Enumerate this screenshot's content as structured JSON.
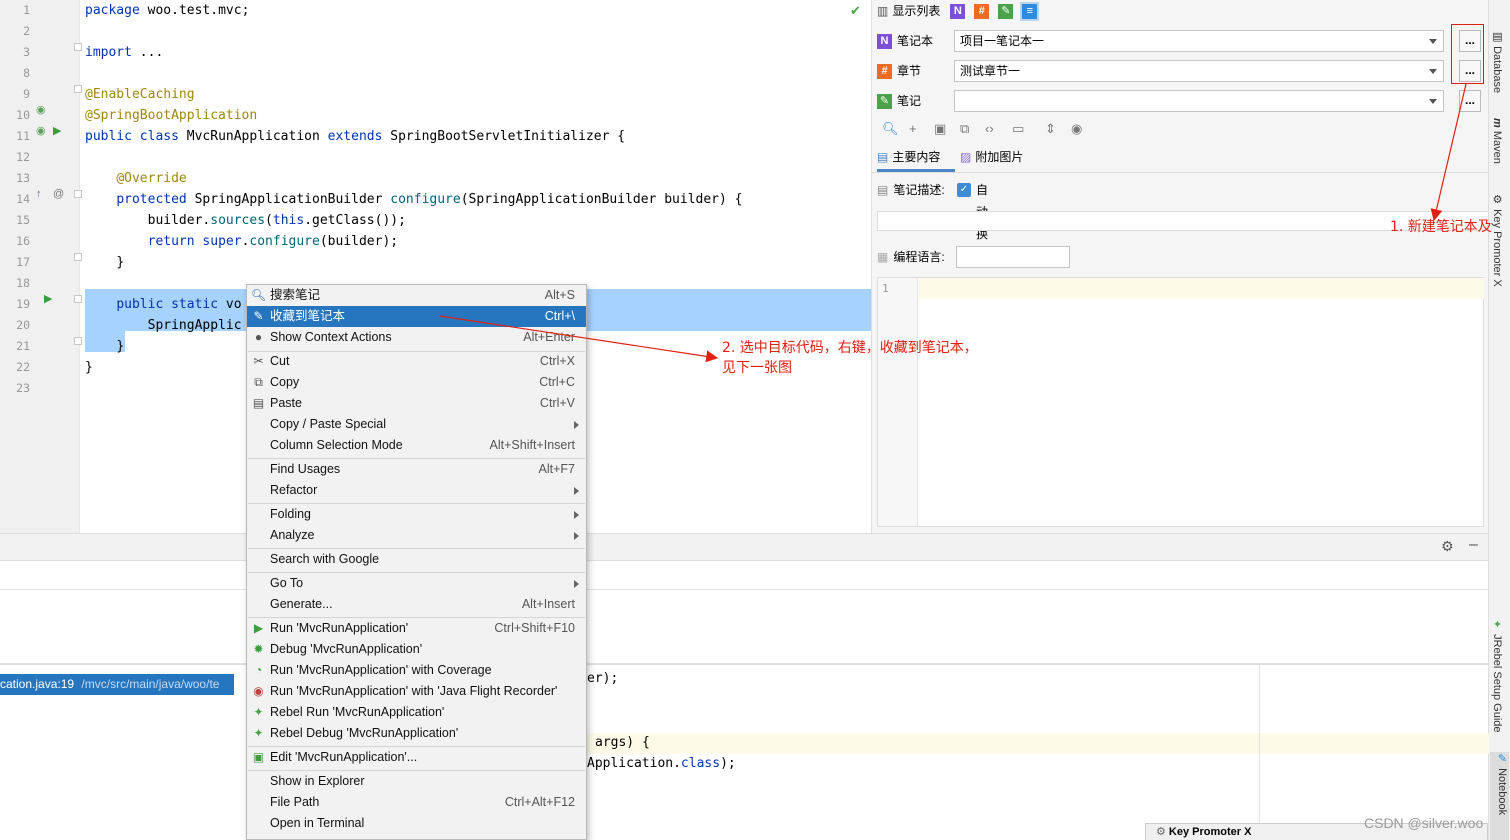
{
  "editor": {
    "lines": [
      {
        "num": "1",
        "text": "package woo.test.mvc;"
      },
      {
        "num": "2",
        "text": ""
      },
      {
        "num": "3",
        "text": "import ..."
      },
      {
        "num": "8",
        "text": ""
      },
      {
        "num": "9",
        "text": "@EnableCaching"
      },
      {
        "num": "10",
        "text": "@SpringBootApplication"
      },
      {
        "num": "11",
        "text": "public class MvcRunApplication extends SpringBootServletInitializer {"
      },
      {
        "num": "12",
        "text": ""
      },
      {
        "num": "13",
        "text": "    @Override"
      },
      {
        "num": "14",
        "text": "    protected SpringApplicationBuilder configure(SpringApplicationBuilder builder) {"
      },
      {
        "num": "15",
        "text": "        builder.sources(this.getClass());"
      },
      {
        "num": "16",
        "text": "        return super.configure(builder);"
      },
      {
        "num": "17",
        "text": "    }"
      },
      {
        "num": "18",
        "text": ""
      },
      {
        "num": "19",
        "text": "    public static vo"
      },
      {
        "num": "20",
        "text": "        SpringApplic"
      },
      {
        "num": "21",
        "text": "    }"
      },
      {
        "num": "22",
        "text": "}"
      },
      {
        "num": "23",
        "text": ""
      }
    ]
  },
  "panel": {
    "display_list_label": "显示列表",
    "notebook_label": "笔记本",
    "notebook_value": "项目一笔记本一",
    "chapter_label": "章节",
    "chapter_value": "测试章节一",
    "note_label": "笔记",
    "note_value": "",
    "dots": "...",
    "tab_main": "主要内容",
    "tab_images": "附加图片",
    "desc_label": "笔记描述:",
    "wrap_label": "自动换行",
    "lang_label": "编程语言:",
    "editor_line": "1"
  },
  "menu": {
    "items": [
      {
        "label": "搜索笔记",
        "shortcut": "Alt+S",
        "icon": "search-icon"
      },
      {
        "label": "收藏到笔记本",
        "shortcut": "Ctrl+\\",
        "icon": "pen-icon"
      },
      {
        "label": "Show Context Actions",
        "shortcut": "Alt+Enter",
        "icon": "bulb-icon"
      },
      {
        "label": "Cut",
        "shortcut": "Ctrl+X",
        "icon": "scissors-icon"
      },
      {
        "label": "Copy",
        "shortcut": "Ctrl+C",
        "icon": "copy-icon"
      },
      {
        "label": "Paste",
        "shortcut": "Ctrl+V",
        "icon": "clipboard-icon"
      },
      {
        "label": "Copy / Paste Special",
        "shortcut": ""
      },
      {
        "label": "Column Selection Mode",
        "shortcut": "Alt+Shift+Insert"
      },
      {
        "label": "Find Usages",
        "shortcut": "Alt+F7"
      },
      {
        "label": "Refactor",
        "shortcut": ""
      },
      {
        "label": "Folding",
        "shortcut": ""
      },
      {
        "label": "Analyze",
        "shortcut": ""
      },
      {
        "label": "Search with Google",
        "shortcut": ""
      },
      {
        "label": "Go To",
        "shortcut": ""
      },
      {
        "label": "Generate...",
        "shortcut": "Alt+Insert"
      },
      {
        "label": "Run 'MvcRunApplication'",
        "shortcut": "Ctrl+Shift+F10",
        "icon": "run-icon"
      },
      {
        "label": "Debug 'MvcRunApplication'",
        "shortcut": "",
        "icon": "debug-icon"
      },
      {
        "label": "Run 'MvcRunApplication' with Coverage",
        "shortcut": "",
        "icon": "coverage-icon"
      },
      {
        "label": "Run 'MvcRunApplication' with 'Java Flight Recorder'",
        "shortcut": "",
        "icon": "recorder-icon"
      },
      {
        "label": "Rebel Run 'MvcRunApplication'",
        "shortcut": "",
        "icon": "rebel-run-icon"
      },
      {
        "label": "Rebel Debug 'MvcRunApplication'",
        "shortcut": "",
        "icon": "rebel-debug-icon"
      },
      {
        "label": "Edit 'MvcRunApplication'...",
        "shortcut": "",
        "icon": "edit-config-icon"
      },
      {
        "label": "Show in Explorer",
        "shortcut": ""
      },
      {
        "label": "File Path",
        "shortcut": "Ctrl+Alt+F12"
      },
      {
        "label": "Open in Terminal",
        "shortcut": ""
      }
    ]
  },
  "results": {
    "file_ref": "cation.java:19",
    "path": "/mvc/src/main/java/woo/te",
    "code1": "er);",
    "code2": "args) {",
    "code3": "Application.",
    "code3_kw": "class",
    "code3_end": ");"
  },
  "stripe": {
    "database": "Database",
    "maven": "Maven",
    "key_promoter": "Key Promoter X",
    "jrebel": "JRebel Setup Guide",
    "notebook": "Notebook"
  },
  "popup_key_promoter": "Key Promoter X",
  "annotations": {
    "note1": "1. 新建笔记本及",
    "note2_line1": "2. 选中目标代码，右键，收藏到笔记本，",
    "note2_line2": "见下一张图"
  },
  "watermark": "CSDN @silver.woo",
  "colors": {
    "selection": "#a6d2ff",
    "menu_highlight": "#2675bf",
    "annotation": "#e02010",
    "keyword": "#0033b3",
    "annotation_code": "#9e880d"
  }
}
